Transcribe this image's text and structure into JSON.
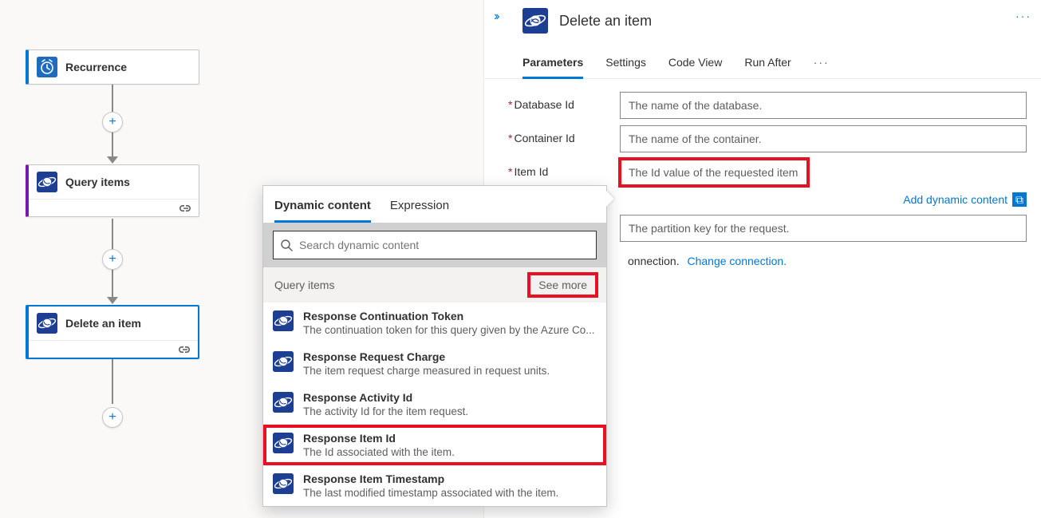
{
  "flow": {
    "nodes": [
      {
        "label": "Recurrence"
      },
      {
        "label": "Query items"
      },
      {
        "label": "Delete an item"
      }
    ]
  },
  "panel": {
    "title": "Delete an item",
    "tabs": {
      "parameters": "Parameters",
      "settings": "Settings",
      "codeview": "Code View",
      "runafter": "Run After"
    },
    "fields": {
      "database": {
        "label": "Database Id",
        "placeholder": "The name of the database."
      },
      "container": {
        "label": "Container Id",
        "placeholder": "The name of the container."
      },
      "item": {
        "label": "Item Id",
        "placeholder": "The Id value of the requested item."
      },
      "partition": {
        "placeholder": "The partition key for the request."
      }
    },
    "add_dynamic": "Add dynamic content",
    "connection_suffix": "onnection.",
    "change_connection": "Change connection."
  },
  "dyn": {
    "tabs": {
      "dynamic": "Dynamic content",
      "expression": "Expression"
    },
    "search_placeholder": "Search dynamic content",
    "section": "Query items",
    "see_more": "See more",
    "items": [
      {
        "title": "Response Continuation Token",
        "desc": "The continuation token for this query given by the Azure Co..."
      },
      {
        "title": "Response Request Charge",
        "desc": "The item request charge measured in request units."
      },
      {
        "title": "Response Activity Id",
        "desc": "The activity Id for the item request."
      },
      {
        "title": "Response Item Id",
        "desc": "The Id associated with the item."
      },
      {
        "title": "Response Item Timestamp",
        "desc": "The last modified timestamp associated with the item."
      }
    ]
  },
  "highlights": {
    "item_id_input": true,
    "see_more": true,
    "response_item_id": true
  }
}
